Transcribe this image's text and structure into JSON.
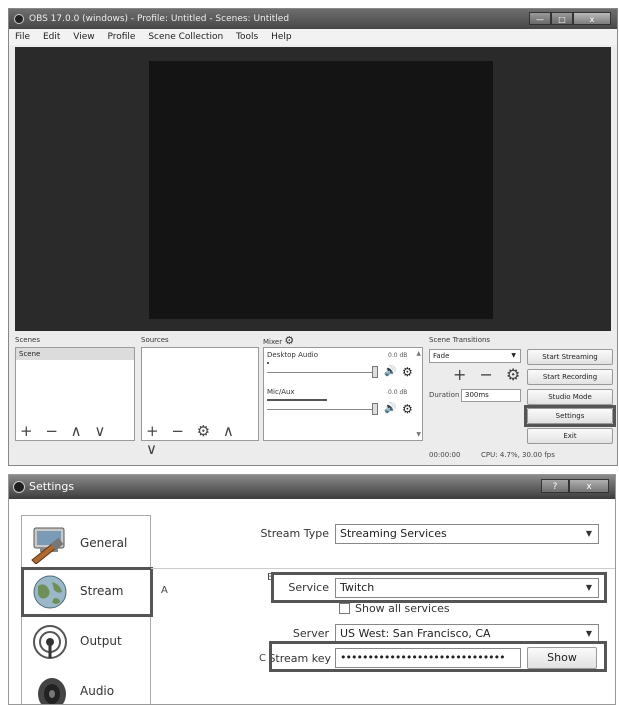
{
  "obs": {
    "title": "OBS 17.0.0 (windows) - Profile: Untitled - Scenes: Untitled",
    "window_buttons": {
      "minimize": "—",
      "maximize": "□",
      "close": "x"
    },
    "menu": [
      "File",
      "Edit",
      "View",
      "Profile",
      "Scene Collection",
      "Tools",
      "Help"
    ],
    "docks": {
      "scenes": {
        "label": "Scenes",
        "items": [
          "Scene"
        ],
        "controls": "+ − ∧ ∨"
      },
      "sources": {
        "label": "Sources",
        "controls": "+ − ⚙ ∧ ∨"
      },
      "mixer": {
        "label": "Mixer",
        "channels": [
          {
            "name": "Desktop Audio",
            "db": "0.0 dB"
          },
          {
            "name": "Mic/Aux",
            "db": "0.0 dB"
          }
        ]
      },
      "transitions": {
        "label": "Scene Transitions",
        "selected": "Fade",
        "controls": "+ − ⚙",
        "duration_label": "Duration",
        "duration_value": "300ms"
      }
    },
    "controls": {
      "start_streaming": "Start Streaming",
      "start_recording": "Start Recording",
      "studio_mode": "Studio Mode",
      "settings": "Settings",
      "exit": "Exit"
    },
    "status": {
      "time": "00:00:00",
      "cpu": "CPU: 4.7%, 30.00 fps"
    }
  },
  "settings": {
    "title": "Settings",
    "window_buttons": {
      "help": "?",
      "close": "x"
    },
    "sidebar": [
      {
        "label": "General",
        "icon": "general-icon"
      },
      {
        "label": "Stream",
        "icon": "globe-icon"
      },
      {
        "label": "Output",
        "icon": "output-icon"
      },
      {
        "label": "Audio",
        "icon": "speaker-icon"
      }
    ],
    "annotations": {
      "a": "A",
      "b": "B",
      "c": "C"
    },
    "stream": {
      "stream_type_label": "Stream Type",
      "stream_type_value": "Streaming Services",
      "service_label": "Service",
      "service_value": "Twitch",
      "show_all_label": "Show all services",
      "server_label": "Server",
      "server_value": "US West: San Francisco, CA",
      "stream_key_label": "Stream key",
      "stream_key_value": "••••••••••••••••••••••••••••••",
      "show_button": "Show"
    }
  }
}
